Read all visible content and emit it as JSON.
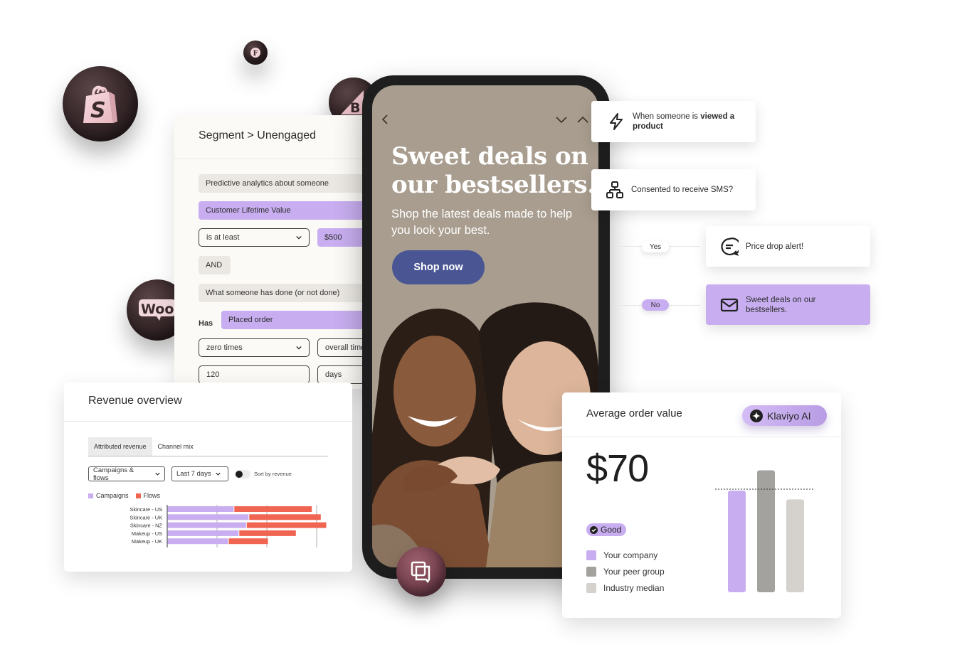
{
  "integrations": [
    {
      "name": "Shopify",
      "icon": "shopify-icon"
    },
    {
      "name": "Feedonomics",
      "icon": "f-logo-icon"
    },
    {
      "name": "BigCommerce",
      "icon": "bigcommerce-icon"
    },
    {
      "name": "WooCommerce",
      "icon": "woocommerce-icon",
      "label": "Woo"
    },
    {
      "name": "Message",
      "icon": "message-stack-icon"
    }
  ],
  "segment": {
    "title": "Segment > Unengaged",
    "condition1": "Predictive analytics about someone",
    "property": "Customer Lifetime Value",
    "operator": "is at least",
    "value": "$500",
    "joiner": "AND",
    "condition2": "What someone has done (or not done)",
    "has_label": "Has",
    "event": "Placed order",
    "frequency": "zero times",
    "timeframe": "overall time",
    "number": "120",
    "unit": "days"
  },
  "phone": {
    "headline_line1": "Sweet deals on",
    "headline_line2": "our bestsellers.",
    "subtitle": "Shop the latest deals made to help you look your best.",
    "cta": "Shop now",
    "colors": {
      "background": "#a89d8e",
      "cta": "#4a5694"
    }
  },
  "flow": {
    "trigger_prefix": "When someone is ",
    "trigger_bold": "viewed a product",
    "split": "Consented to receive SMS?",
    "yes_label": "Yes",
    "no_label": "No",
    "yes_action": "Price drop alert!",
    "no_action": "Sweet deals on our bestsellers."
  },
  "revenue": {
    "title": "Revenue overview",
    "tabs": [
      {
        "label": "Attributed revenue",
        "active": true
      },
      {
        "label": "Channel mix",
        "active": false
      }
    ],
    "filter1": "Campaigns & flows",
    "filter2": "Last 7 days",
    "toggle_label": "Sort by revenue",
    "toggle_on": false
  },
  "aov": {
    "title": "Average order value",
    "ai_badge": "Klaviyo AI",
    "value": "$70",
    "status": "Good",
    "legend": [
      {
        "label": "Your company",
        "color": "#c8aef0"
      },
      {
        "label": "Your peer group",
        "color": "#a3a29e"
      },
      {
        "label": "Industry median",
        "color": "#d5d2cd"
      }
    ]
  },
  "chart_data": [
    {
      "type": "bar",
      "orientation": "horizontal",
      "stacked": true,
      "title": "Revenue overview",
      "categories": [
        "Skincare - US",
        "Skincare - UK",
        "Skincare - NZ",
        "Makeup - US",
        "Makeup - UK"
      ],
      "series": [
        {
          "name": "Campaigns",
          "color": "#c8aef0",
          "values": [
            1.34,
            1.64,
            1.59,
            1.44,
            1.23
          ]
        },
        {
          "name": "Flows",
          "color": "#f06552",
          "values": [
            1.57,
            1.45,
            1.61,
            1.15,
            0.8
          ]
        }
      ],
      "xlim": [
        0,
        3.2
      ],
      "gridlines": [
        0,
        1,
        2,
        3
      ],
      "grid": true,
      "legend": "top-left",
      "xlabel": "",
      "ylabel": ""
    },
    {
      "type": "bar",
      "title": "Average order value",
      "categories": [
        "Your company",
        "Your peer group",
        "Industry median"
      ],
      "values": [
        70,
        84,
        64
      ],
      "colors": [
        "#c8aef0",
        "#a3a29e",
        "#d5d2cd"
      ],
      "reference_line": 71,
      "ylim": [
        0,
        90
      ],
      "legend": "left"
    }
  ]
}
